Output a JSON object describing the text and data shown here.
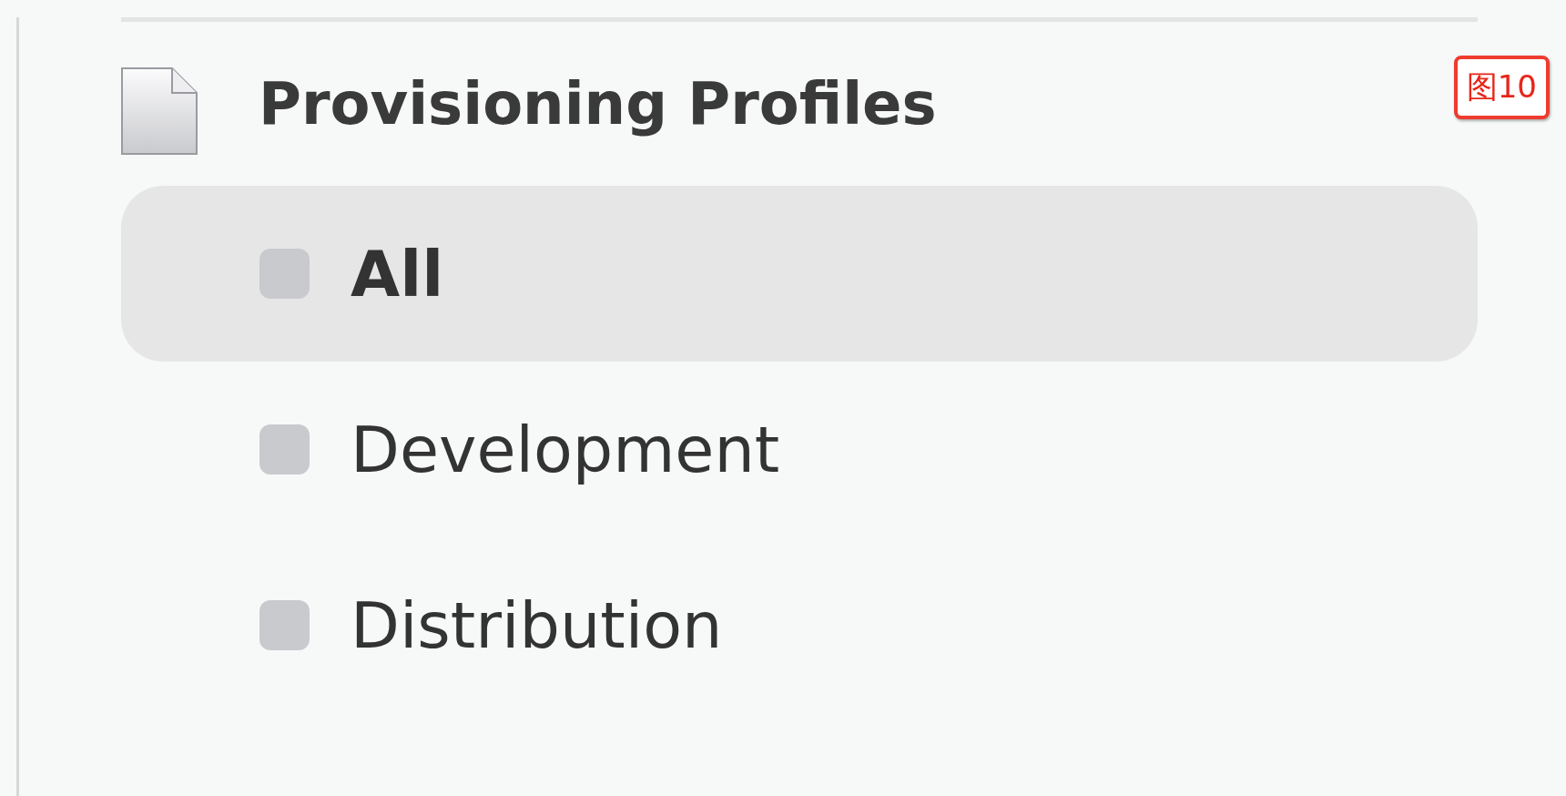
{
  "section": {
    "title": "Provisioning Profiles"
  },
  "items": [
    {
      "label": "All",
      "selected": true
    },
    {
      "label": "Development",
      "selected": false
    },
    {
      "label": "Distribution",
      "selected": false
    }
  ],
  "figure_label": "图10"
}
